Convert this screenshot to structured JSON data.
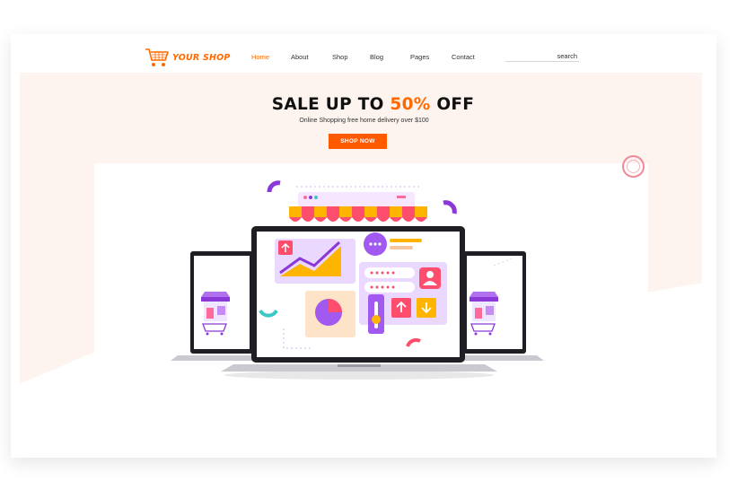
{
  "brand": {
    "name": "YOUR SHOP",
    "color": "#ff6a00"
  },
  "nav": {
    "items": [
      {
        "label": "Home",
        "active": true
      },
      {
        "label": "About",
        "active": false
      },
      {
        "label": "Shop",
        "active": false
      },
      {
        "label": "Blog",
        "active": false
      },
      {
        "label": "Pages",
        "active": false
      },
      {
        "label": "Contact",
        "active": false
      }
    ],
    "search": {
      "label": "search",
      "value": ""
    }
  },
  "hero": {
    "headline_prefix": "SALE UP TO ",
    "headline_accent": "50%",
    "headline_suffix": " OFF",
    "subline": "Online Shopping free home delivery over $100",
    "cta_label": "SHOP NOW",
    "accent_color": "#ff5a00",
    "background_color": "#fdf3ef"
  },
  "illustration": {
    "icons": [
      "shopping-cart-icon",
      "store-awning-icon",
      "laptop-icon",
      "line-chart-icon",
      "pie-chart-icon",
      "chat-bubble-icon",
      "user-icon",
      "arrow-up-icon",
      "arrow-down-icon"
    ]
  }
}
